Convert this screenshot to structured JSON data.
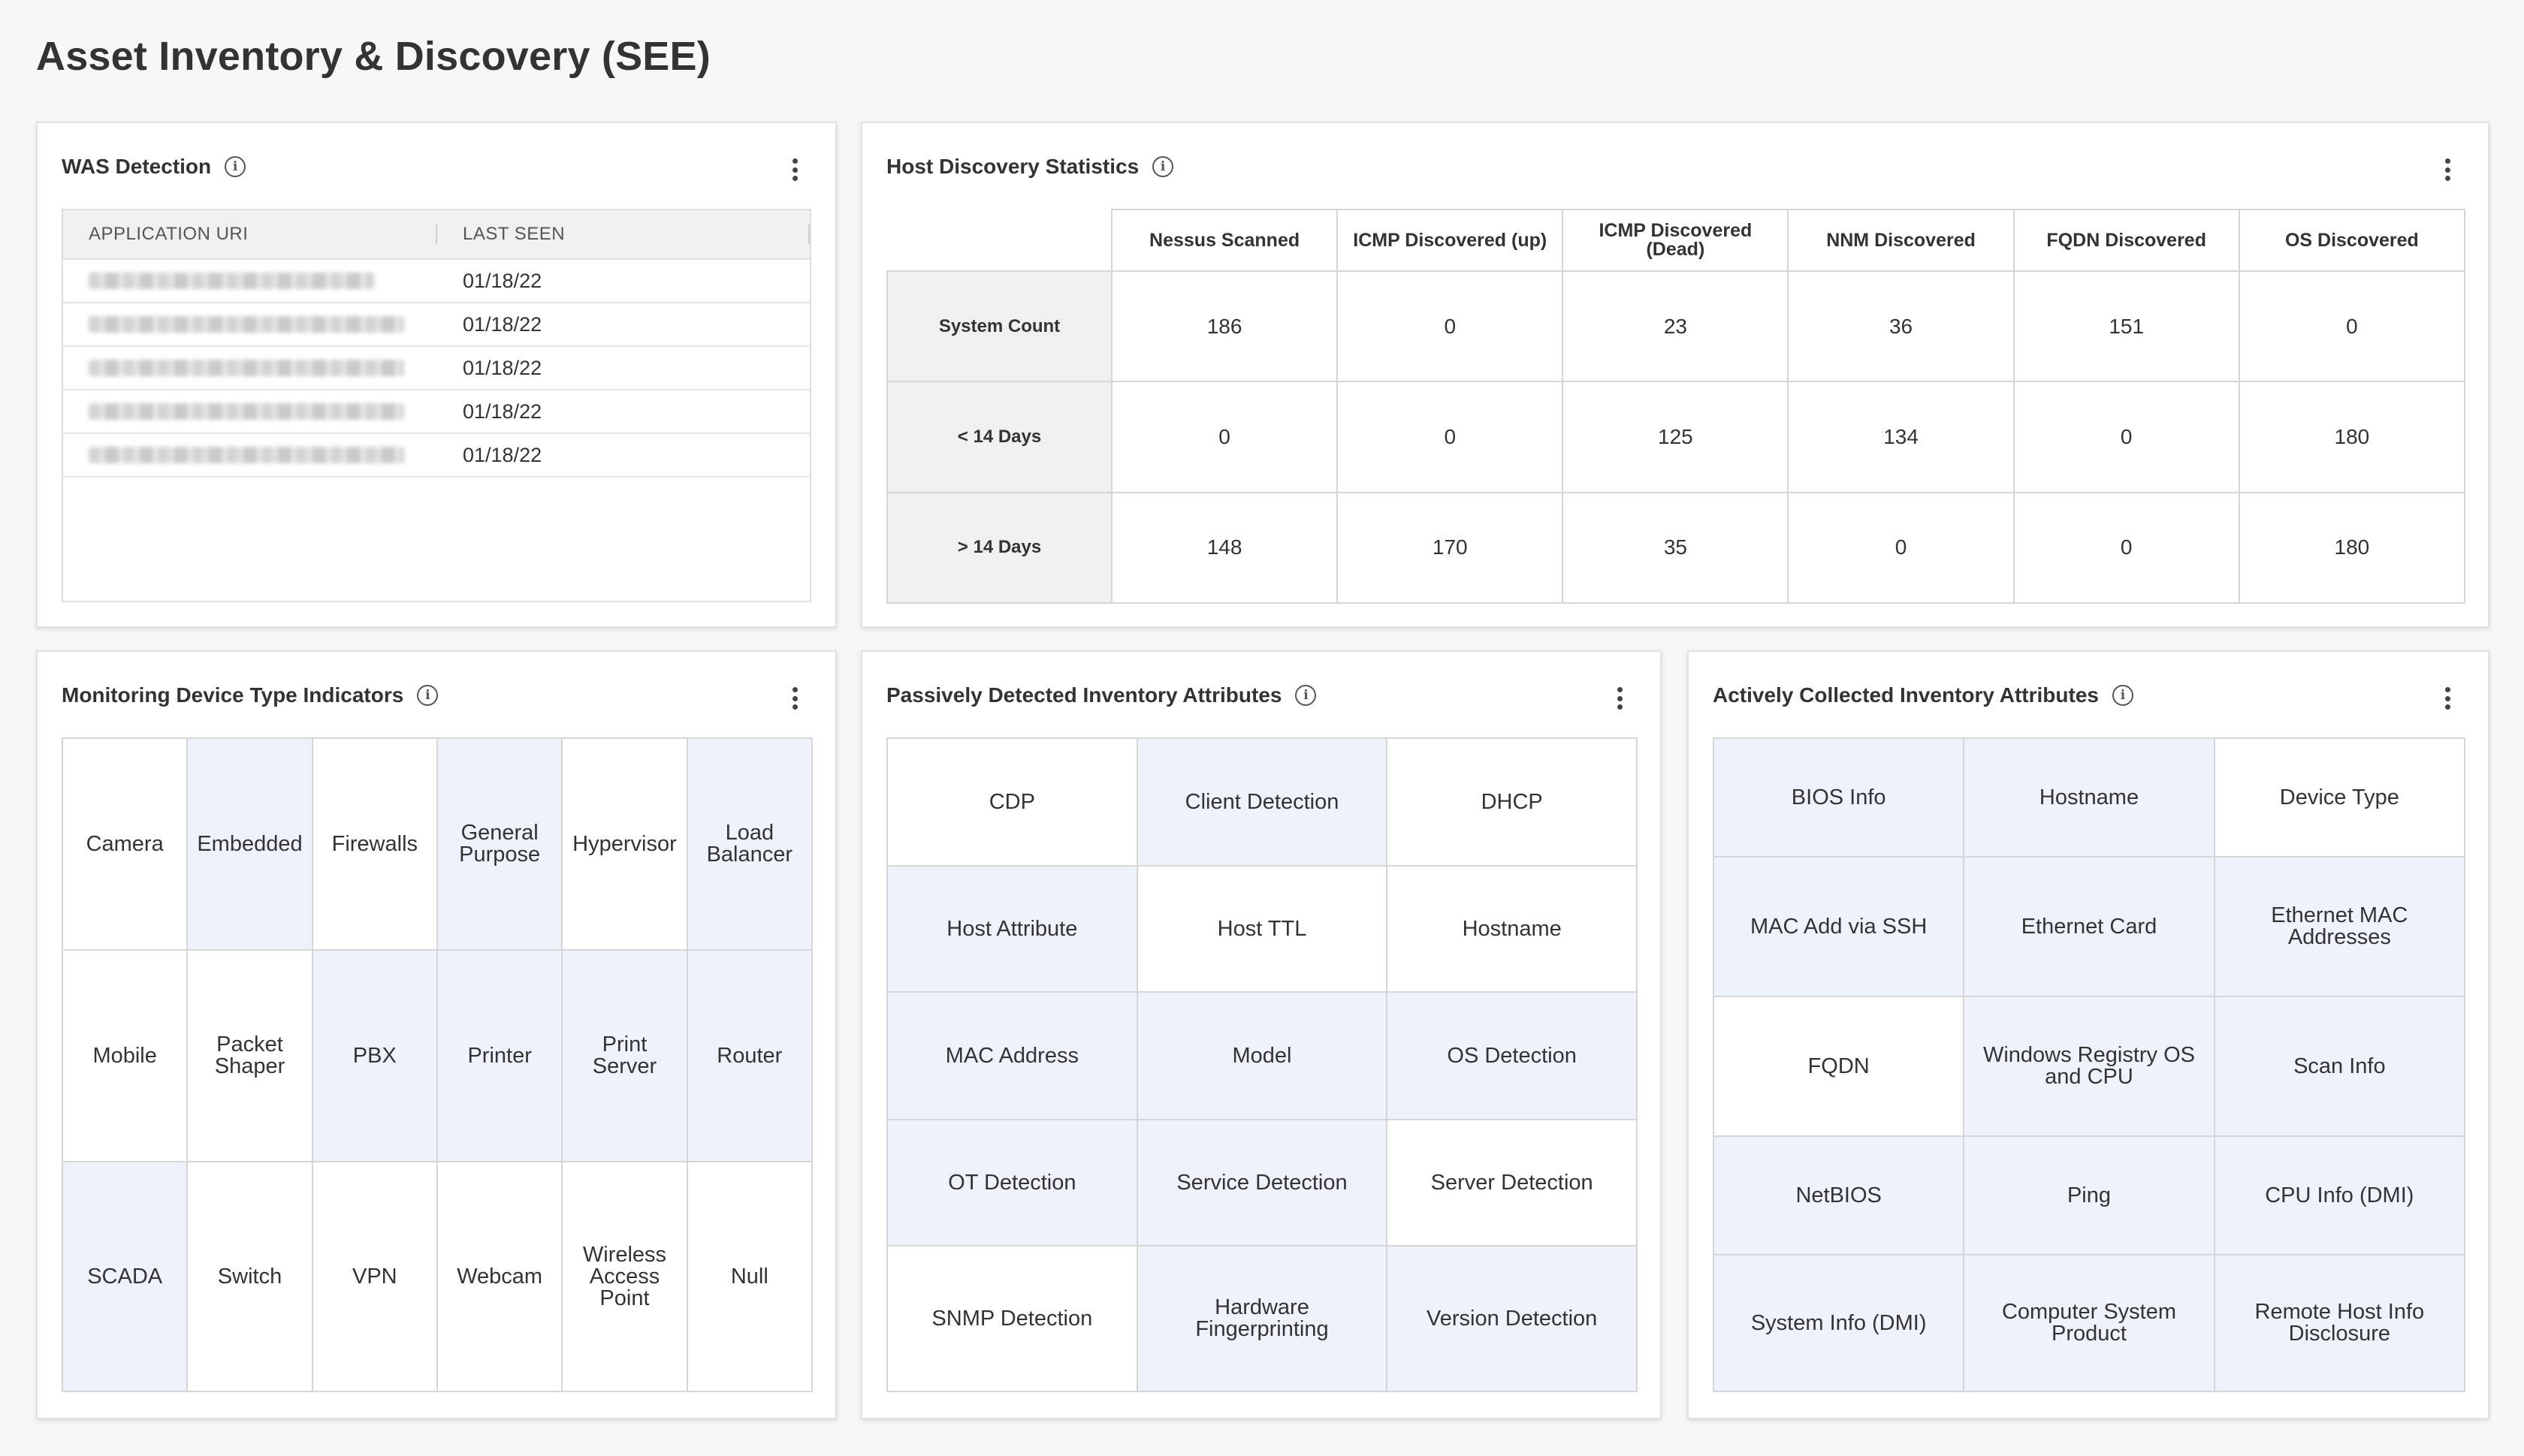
{
  "page": {
    "title": "Asset Inventory & Discovery (SEE)"
  },
  "was": {
    "title": "WAS Detection",
    "columns": [
      "APPLICATION URI",
      "LAST SEEN"
    ],
    "rows": [
      {
        "last_seen": "01/18/22"
      },
      {
        "last_seen": "01/18/22"
      },
      {
        "last_seen": "01/18/22"
      },
      {
        "last_seen": "01/18/22"
      },
      {
        "last_seen": "01/18/22"
      }
    ]
  },
  "host": {
    "title": "Host Discovery Statistics",
    "columns": [
      "Nessus Scanned",
      "ICMP Discovered (up)",
      "ICMP Discovered (Dead)",
      "NNM Discovered",
      "FQDN Discovered",
      "OS Discovered"
    ],
    "rows": [
      {
        "label": "System Count",
        "values": [
          "186",
          "0",
          "23",
          "36",
          "151",
          "0"
        ]
      },
      {
        "label": "< 14 Days",
        "values": [
          "0",
          "0",
          "125",
          "134",
          "0",
          "180"
        ]
      },
      {
        "label": "> 14 Days",
        "values": [
          "148",
          "170",
          "35",
          "0",
          "0",
          "180"
        ]
      }
    ]
  },
  "monitor": {
    "title": "Monitoring Device Type Indicators",
    "cells": [
      [
        "Camera",
        "Embedded",
        "Firewalls",
        "General Purpose",
        "Hypervisor",
        "Load Balancer"
      ],
      [
        "Mobile",
        "Packet Shaper",
        "PBX",
        "Printer",
        "Print Server",
        "Router"
      ],
      [
        "SCADA",
        "Switch",
        "VPN",
        "Webcam",
        "Wireless Access Point",
        "Null"
      ]
    ]
  },
  "passive": {
    "title": "Passively Detected Inventory Attributes",
    "cells": [
      [
        "CDP",
        "Client Detection",
        "DHCP"
      ],
      [
        "Host Attribute",
        "Host TTL",
        "Hostname"
      ],
      [
        "MAC Address",
        "Model",
        "OS Detection"
      ],
      [
        "OT Detection",
        "Service Detection",
        "Server Detection"
      ],
      [
        "SNMP Detection",
        "Hardware Fingerprinting",
        "Version Detection"
      ]
    ]
  },
  "active": {
    "title": "Actively Collected Inventory Attributes",
    "cells": [
      [
        "BIOS Info",
        "Hostname",
        "Device Type"
      ],
      [
        "MAC Add via SSH",
        "Ethernet Card",
        "Ethernet MAC Addresses"
      ],
      [
        "FQDN",
        "Windows Registry OS and CPU",
        "Scan Info"
      ],
      [
        "NetBIOS",
        "Ping",
        "CPU Info (DMI)"
      ],
      [
        "System Info (DMI)",
        "Computer System Product",
        "Remote Host Info Disclosure"
      ]
    ]
  },
  "colors": {
    "highlight": "#eef3fb",
    "header_gray": "#f0f0f0",
    "border": "#d6d6d6"
  }
}
